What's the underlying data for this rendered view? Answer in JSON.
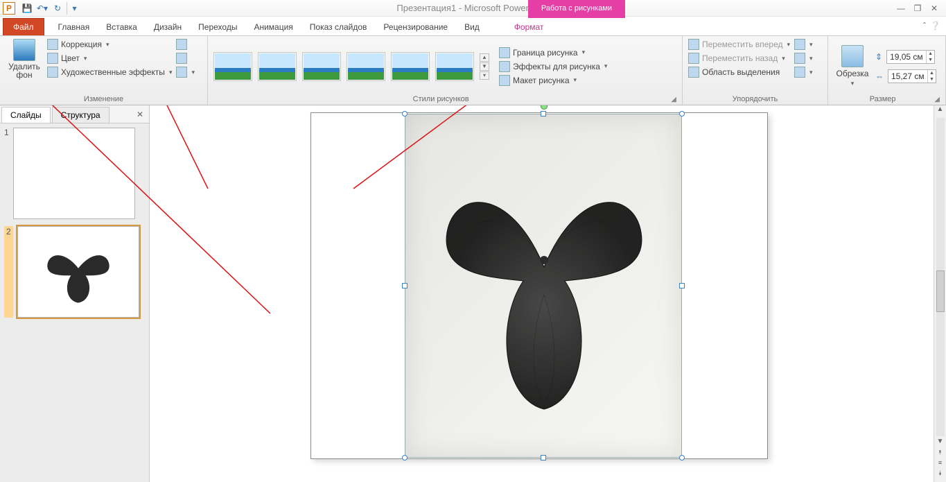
{
  "title": "Презентация1 - Microsoft PowerPoint",
  "context_tab": "Работа с рисунками",
  "tabs": {
    "file": "Файл",
    "home": "Главная",
    "insert": "Вставка",
    "design": "Дизайн",
    "transitions": "Переходы",
    "animations": "Анимация",
    "slideshow": "Показ слайдов",
    "review": "Рецензирование",
    "view": "Вид",
    "format": "Формат"
  },
  "ribbon": {
    "remove_bg": "Удалить фон",
    "corrections": "Коррекция",
    "color": "Цвет",
    "artistic": "Художественные эффекты",
    "group_change": "Изменение",
    "group_styles": "Стили рисунков",
    "pic_border": "Граница рисунка",
    "pic_effects": "Эффекты для рисунка",
    "pic_layout": "Макет рисунка",
    "bring_forward": "Переместить вперед",
    "send_backward": "Переместить назад",
    "selection_pane": "Область выделения",
    "group_arrange": "Упорядочить",
    "crop": "Обрезка",
    "group_size": "Размер",
    "height": "19,05 см",
    "width": "15,27 см"
  },
  "slidepanel": {
    "tab_slides": "Слайды",
    "tab_outline": "Структура",
    "slide1_num": "1",
    "slide2_num": "2"
  }
}
